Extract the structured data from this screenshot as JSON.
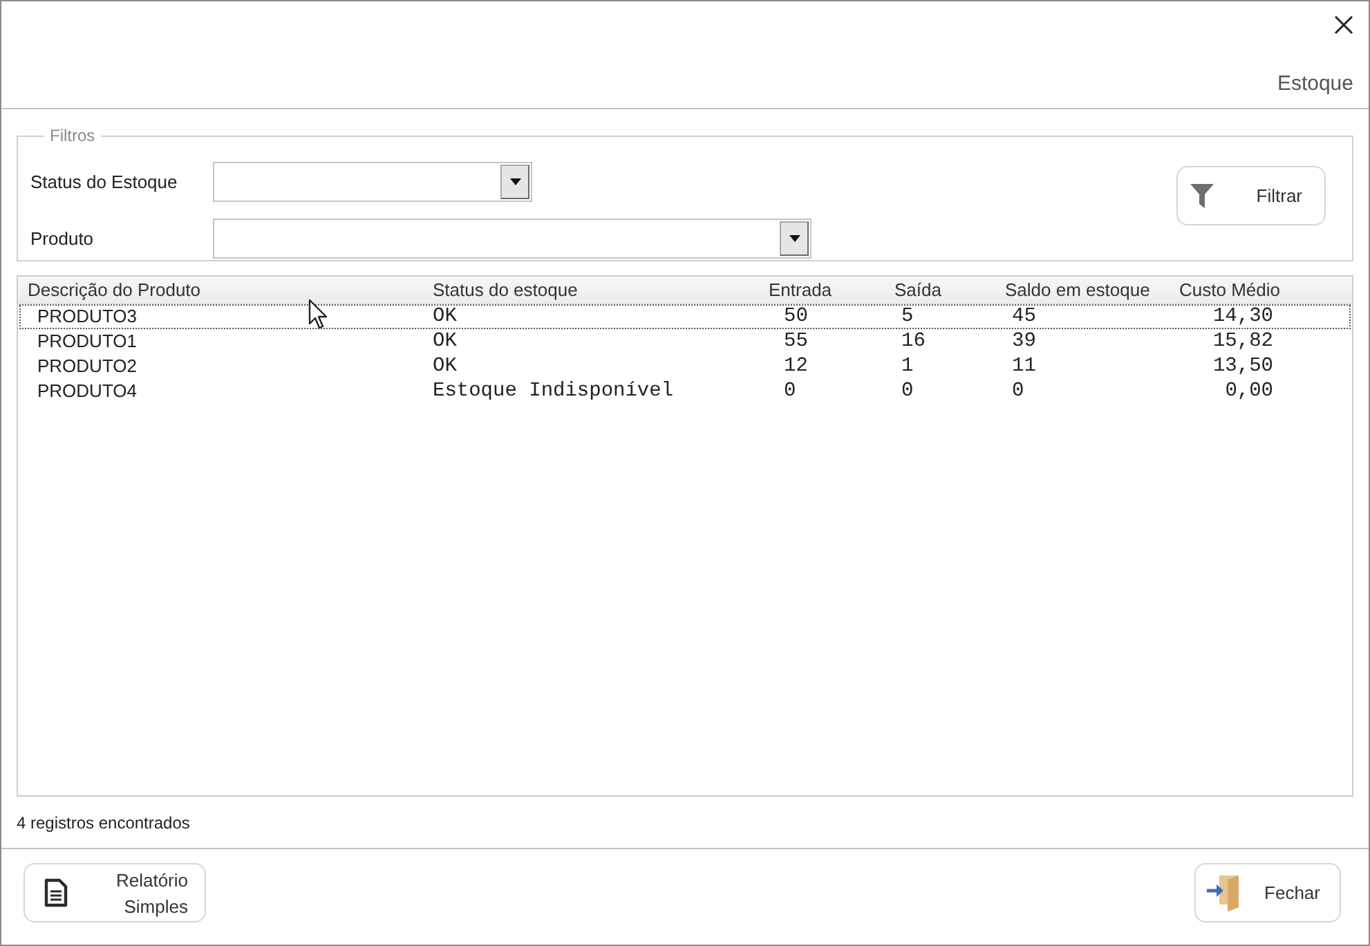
{
  "window": {
    "title": "Estoque"
  },
  "filters": {
    "legend": "Filtros",
    "fields": [
      {
        "label": "Status do Estoque"
      },
      {
        "label": "Produto"
      }
    ],
    "button": {
      "label": "Filtrar"
    }
  },
  "table": {
    "columns": [
      "Descrição do Produto",
      "Status do estoque",
      "Entrada",
      "Saída",
      "Saldo em estoque",
      "Custo Médio"
    ],
    "rows": [
      {
        "selected": true,
        "cells": [
          "PRODUTO3",
          "OK",
          "50",
          "5",
          "45",
          "14,30"
        ]
      },
      {
        "selected": false,
        "cells": [
          "PRODUTO1",
          "OK",
          "55",
          "16",
          "39",
          "15,82"
        ]
      },
      {
        "selected": false,
        "cells": [
          "PRODUTO2",
          "OK",
          "12",
          "1",
          "11",
          "13,50"
        ]
      },
      {
        "selected": false,
        "cells": [
          "PRODUTO4",
          "Estoque Indisponível",
          "0",
          "0",
          "0",
          "0,00"
        ]
      }
    ]
  },
  "status_bar": {
    "text": "4 registros encontrados"
  },
  "buttons": [
    {
      "kind": "report",
      "label": "Relatório Simples"
    },
    {
      "kind": "exit",
      "label": "Fechar"
    }
  ]
}
